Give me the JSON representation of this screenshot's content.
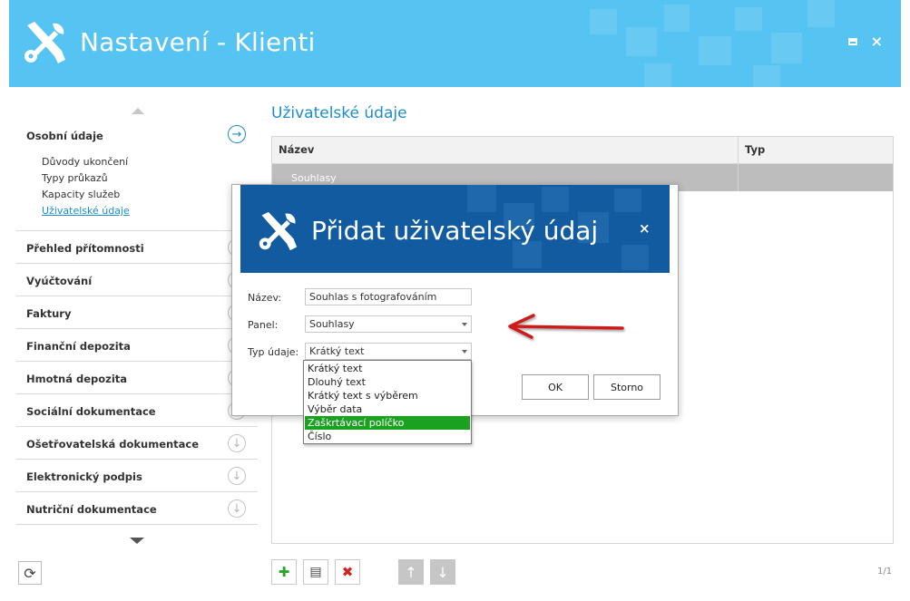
{
  "window": {
    "title": "Nastavení - Klienti",
    "maximize_icon": "maximize-icon",
    "close_glyph": "×"
  },
  "sidebar": {
    "sections": [
      {
        "label": "Osobní údaje",
        "expanded": true,
        "icon": "arrow-right-circle-icon",
        "items": [
          "Důvody ukončení",
          "Typy průkazů",
          "Kapacity služeb",
          "Uživatelské údaje"
        ],
        "active_item": "Uživatelské údaje"
      },
      {
        "label": "Přehled přítomnosti"
      },
      {
        "label": "Vyúčtování"
      },
      {
        "label": "Faktury"
      },
      {
        "label": "Finanční depozita"
      },
      {
        "label": "Hmotná depozita"
      },
      {
        "label": "Sociální dokumentace"
      },
      {
        "label": "Ošetřovatelská dokumentace"
      },
      {
        "label": "Elektronický podpis"
      },
      {
        "label": "Nutriční dokumentace"
      }
    ],
    "arrow_down_glyph": "↓",
    "arrow_right_glyph": "→",
    "refresh_glyph": "⟳"
  },
  "main": {
    "title": "Uživatelské údaje",
    "table": {
      "columns": [
        "Název",
        "Typ"
      ],
      "rows": [
        [
          "Souhlasy",
          ""
        ]
      ]
    },
    "toolbar": {
      "add_glyph": "✚",
      "edit_glyph": "▤",
      "delete_glyph": "✖",
      "up_glyph": "↑",
      "down_glyph": "↓"
    },
    "page_count": "1/1"
  },
  "dialog": {
    "title": "Přidat uživatelský údaj",
    "close_glyph": "×",
    "fields": {
      "name_label": "Název:",
      "name_value": "Souhlas s fotografováním",
      "panel_label": "Panel:",
      "panel_value": "Souhlasy",
      "type_label": "Typ údaje:",
      "type_value": "Krátký text"
    },
    "ok_label": "OK",
    "cancel_label": "Storno",
    "type_options": [
      "Krátký text",
      "Dlouhý text",
      "Krátký text s výběrem",
      "Výběr data",
      "Zaškrtávací políčko",
      "Číslo"
    ],
    "highlighted_option": "Zaškrtávací políčko"
  },
  "colors": {
    "header_bg": "#56c4f2",
    "dialog_header_bg": "#125ba1",
    "accent_blue": "#1b8dc9",
    "selected_option": "#19a11f",
    "annotation_arrow": "#cc1f1f",
    "add_icon": "#2aa52a",
    "delete_icon": "#d42020"
  }
}
